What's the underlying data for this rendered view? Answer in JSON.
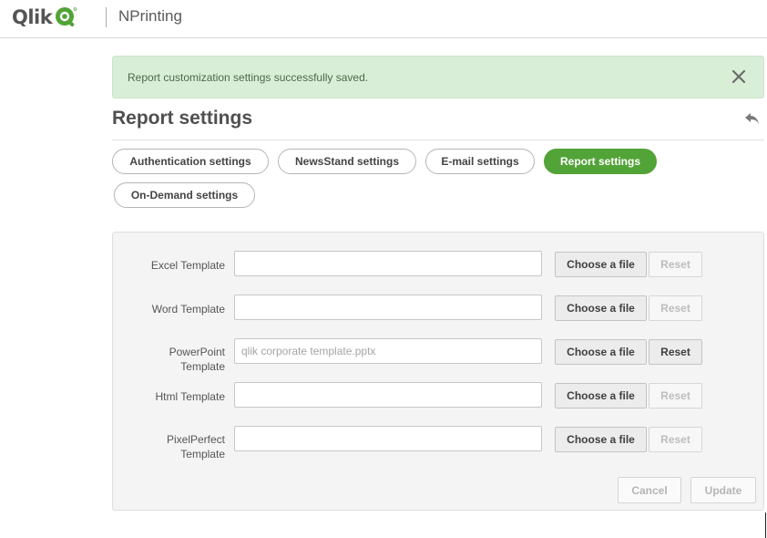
{
  "header": {
    "logo_text": "Qlik",
    "product_name": "NPrinting"
  },
  "alert": {
    "message": "Report customization settings successfully saved.",
    "close_icon": "close-icon"
  },
  "page": {
    "title": "Report settings",
    "back_icon": "back-arrow-icon"
  },
  "tabs": [
    {
      "label": "Authentication settings",
      "active": false
    },
    {
      "label": "NewsStand settings",
      "active": false
    },
    {
      "label": "E-mail settings",
      "active": false
    },
    {
      "label": "Report settings",
      "active": true
    },
    {
      "label": "On-Demand settings",
      "active": false
    }
  ],
  "templates": [
    {
      "label": "Excel Template",
      "value": "",
      "placeholder": "",
      "choose_label": "Choose a file",
      "reset_label": "Reset",
      "reset_enabled": false
    },
    {
      "label": "Word Template",
      "value": "",
      "placeholder": "",
      "choose_label": "Choose a file",
      "reset_label": "Reset",
      "reset_enabled": false
    },
    {
      "label": "PowerPoint Template",
      "label_lines": [
        "PowerPoint",
        "Template"
      ],
      "value": "",
      "placeholder": "qlik corporate template.pptx",
      "choose_label": "Choose a file",
      "reset_label": "Reset",
      "reset_enabled": true
    },
    {
      "label": "Html Template",
      "value": "",
      "placeholder": "",
      "choose_label": "Choose a file",
      "reset_label": "Reset",
      "reset_enabled": false
    },
    {
      "label": "PixelPerfect Template",
      "label_lines": [
        "PixelPerfect",
        "Template"
      ],
      "value": "",
      "placeholder": "",
      "choose_label": "Choose a file",
      "reset_label": "Reset",
      "reset_enabled": false
    }
  ],
  "footer": {
    "cancel_label": "Cancel",
    "update_label": "Update"
  },
  "colors": {
    "brand_green": "#52a338",
    "alert_bg": "#d9eed7"
  }
}
